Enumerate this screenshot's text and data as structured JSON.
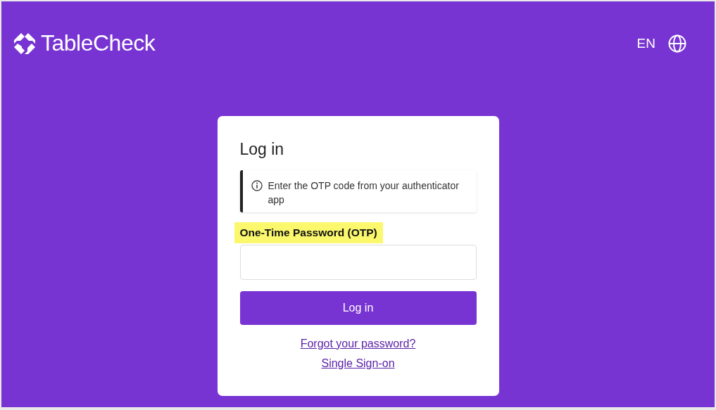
{
  "header": {
    "brand": "TableCheck",
    "language": "EN"
  },
  "card": {
    "title": "Log in",
    "notice": "Enter the OTP code from your authenticator app",
    "field": {
      "label": "One-Time Password (OTP)",
      "highlighted": true
    },
    "button": "Log in",
    "links": [
      "Forgot your password?",
      "Single Sign-on"
    ]
  }
}
